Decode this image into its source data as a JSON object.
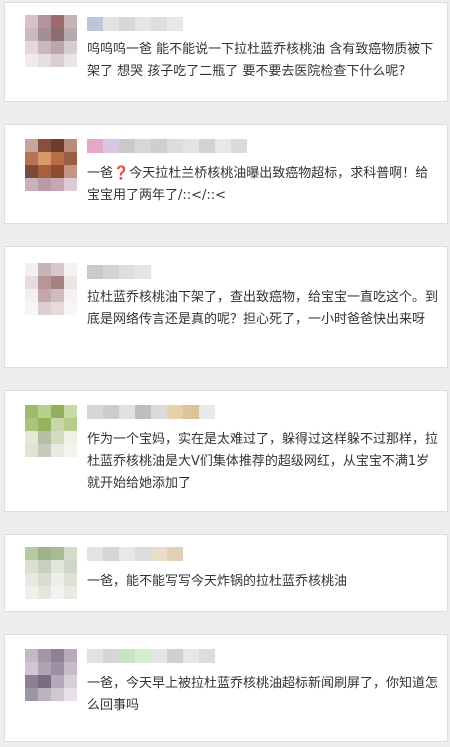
{
  "comments": [
    {
      "text": "呜呜呜一爸 能不能说一下拉杜蓝乔核桃油 含有致癌物质被下架了 想哭 孩子吃了二瓶了 要不要去医院检查下什么呢?",
      "avatar_colors": [
        "#d6c2c8",
        "#b4949c",
        "#a06a6a",
        "#c7b2b6",
        "#cdb9bd",
        "#a39094",
        "#8a6d6f",
        "#b9a8ac",
        "#e2d7da",
        "#c9b9bc",
        "#bba6aa",
        "#d8cdd0",
        "#f1eaec",
        "#e6dde0",
        "#d9cfd2",
        "#ece5e7"
      ],
      "name_colors": [
        "#b9c6dc",
        "#e2e2e2",
        "#d8d8d8",
        "#e6e6e6",
        "#dedede",
        "#e9e9e9"
      ]
    },
    {
      "text_before": "一爸",
      "text_emoji": "❓",
      "text_after": "今天拉杜兰桥核桃油曝出致癌物超标，求科普啊！给宝宝用了两年了/::</::<",
      "avatar_colors": [
        "#c7a6a0",
        "#8a4f3a",
        "#6e3b2c",
        "#b98c7c",
        "#b57456",
        "#d89a6a",
        "#b86e44",
        "#9b5e45",
        "#7b4a39",
        "#a85f3e",
        "#8d4d33",
        "#c49480",
        "#c8b2b8",
        "#b99aa6",
        "#c6a8b2",
        "#dccbd2"
      ],
      "name_colors": [
        "#e6a8c8",
        "#d9c6e3",
        "#c9c9c9",
        "#d7d7d7",
        "#cfcfcf",
        "#dcdcdc",
        "#e3e3e3",
        "#d2d2d2",
        "#e8e8e8",
        "#dbdbdb"
      ]
    },
    {
      "text": "拉杜蓝乔核桃油下架了，查出致癌物，给宝宝一直吃这个。到底是网络传言还是真的呢？担心死了，一小时爸爸快出来呀",
      "avatar_colors": [
        "#f4f0f0",
        "#c8b4b6",
        "#d8c8c9",
        "#f6f2f2",
        "#e7dcdd",
        "#b89596",
        "#a67f7f",
        "#ece3e3",
        "#f3efef",
        "#c2a8a9",
        "#d0bcbc",
        "#f5f1f1",
        "#f7f4f4",
        "#ddcfcf",
        "#e6dbdb",
        "#f8f5f5"
      ],
      "name_colors": [
        "#c9c9c9",
        "#d3d3d3",
        "#dedede",
        "#e5e5e5"
      ]
    },
    {
      "text": "作为一个宝妈，实在是太难过了，躲得过这样躲不过那样，拉杜蓝乔核桃油是大V们集体推荐的超级网红，从宝宝不满1岁就开始给她添加了",
      "avatar_colors": [
        "#9dbb6a",
        "#b9cf8e",
        "#8fb05c",
        "#c8d9a4",
        "#a8c47c",
        "#93b35e",
        "#c9d7a8",
        "#b6cb8c",
        "#e4ead4",
        "#b3c1a0",
        "#d2dcc0",
        "#eef1e6",
        "#dfe4d6",
        "#c6cbbd",
        "#e8ebe2",
        "#f2f4ee"
      ],
      "name_colors": [
        "#d6d6d6",
        "#cccccc",
        "#e0e0e0",
        "#c3bcbc",
        "#dadada",
        "#e6d2a8",
        "#dcc49a",
        "#e9e9e9"
      ]
    },
    {
      "text": "一爸，能不能写写今天炸锅的拉杜蓝乔核桃油",
      "avatar_colors": [
        "#b9c9a8",
        "#9fb389",
        "#a8bb92",
        "#d3dcc7",
        "#d9dfd2",
        "#c7cfbd",
        "#e1e5da",
        "#cfd6c5",
        "#e6e9e1",
        "#d8ddd0",
        "#edf0ea",
        "#dde2d5",
        "#eef0ea",
        "#e3e6de",
        "#f1f3ef",
        "#e8ebe4"
      ],
      "name_colors": [
        "#e3e3e3",
        "#d5d5d5",
        "#e8e8e8",
        "#dcdcdc",
        "#e9dcc8",
        "#e2d1b6"
      ]
    },
    {
      "text": "一爸，今天早上被拉杜蓝乔核桃油超标新闻刷屏了，你知道怎么回事吗",
      "avatar_colors": [
        "#c3b9c6",
        "#a495a8",
        "#8f8094",
        "#b7abbb",
        "#d3c6d2",
        "#b3a2b3",
        "#9f8fa3",
        "#c8bcc9",
        "#8c8094",
        "#7a6c80",
        "#b2a8b8",
        "#d6cfda",
        "#9d95a2",
        "#bab2bf",
        "#cfc8d2",
        "#e6e2e8"
      ],
      "name_colors": [
        "#e1e1e1",
        "#d6d6d6",
        "#c9e4c4",
        "#d8ecd3",
        "#e4e4e4",
        "#d0d0d0",
        "#e7e7e7",
        "#dcdcdc"
      ]
    }
  ]
}
